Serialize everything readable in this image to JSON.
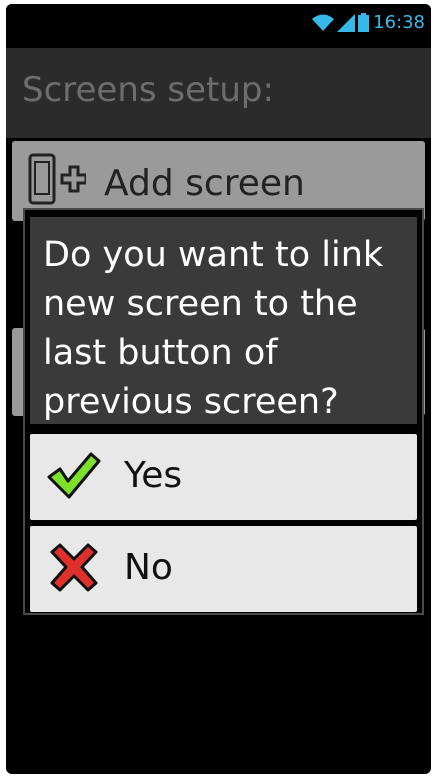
{
  "status_bar": {
    "time": "16:38",
    "icons": [
      "wifi-icon",
      "signal-icon",
      "battery-icon"
    ]
  },
  "app": {
    "title": "Screens setup:",
    "add_screen_label": "Add screen"
  },
  "dialog": {
    "message": "Do you want to link new screen to the last button of previous screen?",
    "yes_label": "Yes",
    "no_label": "No"
  },
  "colors": {
    "status_accent": "#36b9e9",
    "check_green": "#7be12a",
    "cross_red": "#e0302b"
  }
}
